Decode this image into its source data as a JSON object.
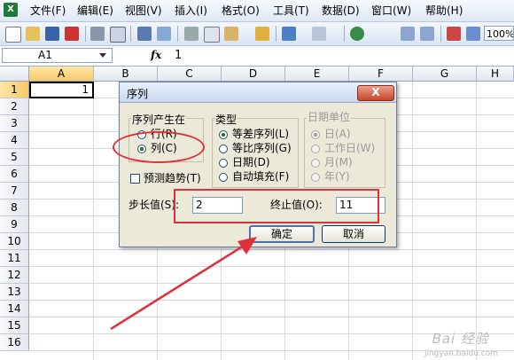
{
  "menubar": {
    "items": [
      "文件(F)",
      "编辑(E)",
      "视图(V)",
      "插入(I)",
      "格式(O)",
      "工具(T)",
      "数据(D)",
      "窗口(W)",
      "帮助(H)"
    ]
  },
  "toolbar": {
    "sum_symbol": "Σ",
    "zoom": "100%"
  },
  "formulabar": {
    "name_box": "A1",
    "fx_label": "fx",
    "value": "1"
  },
  "grid": {
    "columns": [
      "A",
      "B",
      "C",
      "D",
      "E",
      "F",
      "G",
      "H"
    ],
    "rows": [
      "1",
      "2",
      "3",
      "4",
      "5",
      "6",
      "7",
      "8",
      "9",
      "10",
      "11",
      "12",
      "13",
      "14",
      "15",
      "16"
    ],
    "active_column": "A",
    "active_row": "1",
    "cell_a1": "1"
  },
  "dialog": {
    "title": "序列",
    "close_symbol": "X",
    "series_in": {
      "label": "序列产生在",
      "options": [
        "行(R)",
        "列(C)"
      ],
      "selected": 1
    },
    "type": {
      "label": "类型",
      "options": [
        "等差序列(L)",
        "等比序列(G)",
        "日期(D)",
        "自动填充(F)"
      ],
      "selected": 0
    },
    "date_unit": {
      "label": "日期单位",
      "options": [
        "日(A)",
        "工作日(W)",
        "月(M)",
        "年(Y)"
      ],
      "selected": 0
    },
    "trend_label": "预测趋势(T)",
    "step_label": "步长值(S):",
    "step_value": "2",
    "stop_label": "终止值(O):",
    "stop_value": "11",
    "ok_label": "确定",
    "cancel_label": "取消"
  },
  "colors": {
    "annotation": "#e0303a",
    "active_header": "#f8c96a"
  },
  "watermark": {
    "text": "Bai 经验",
    "url": "jingyan.baidu.com"
  }
}
